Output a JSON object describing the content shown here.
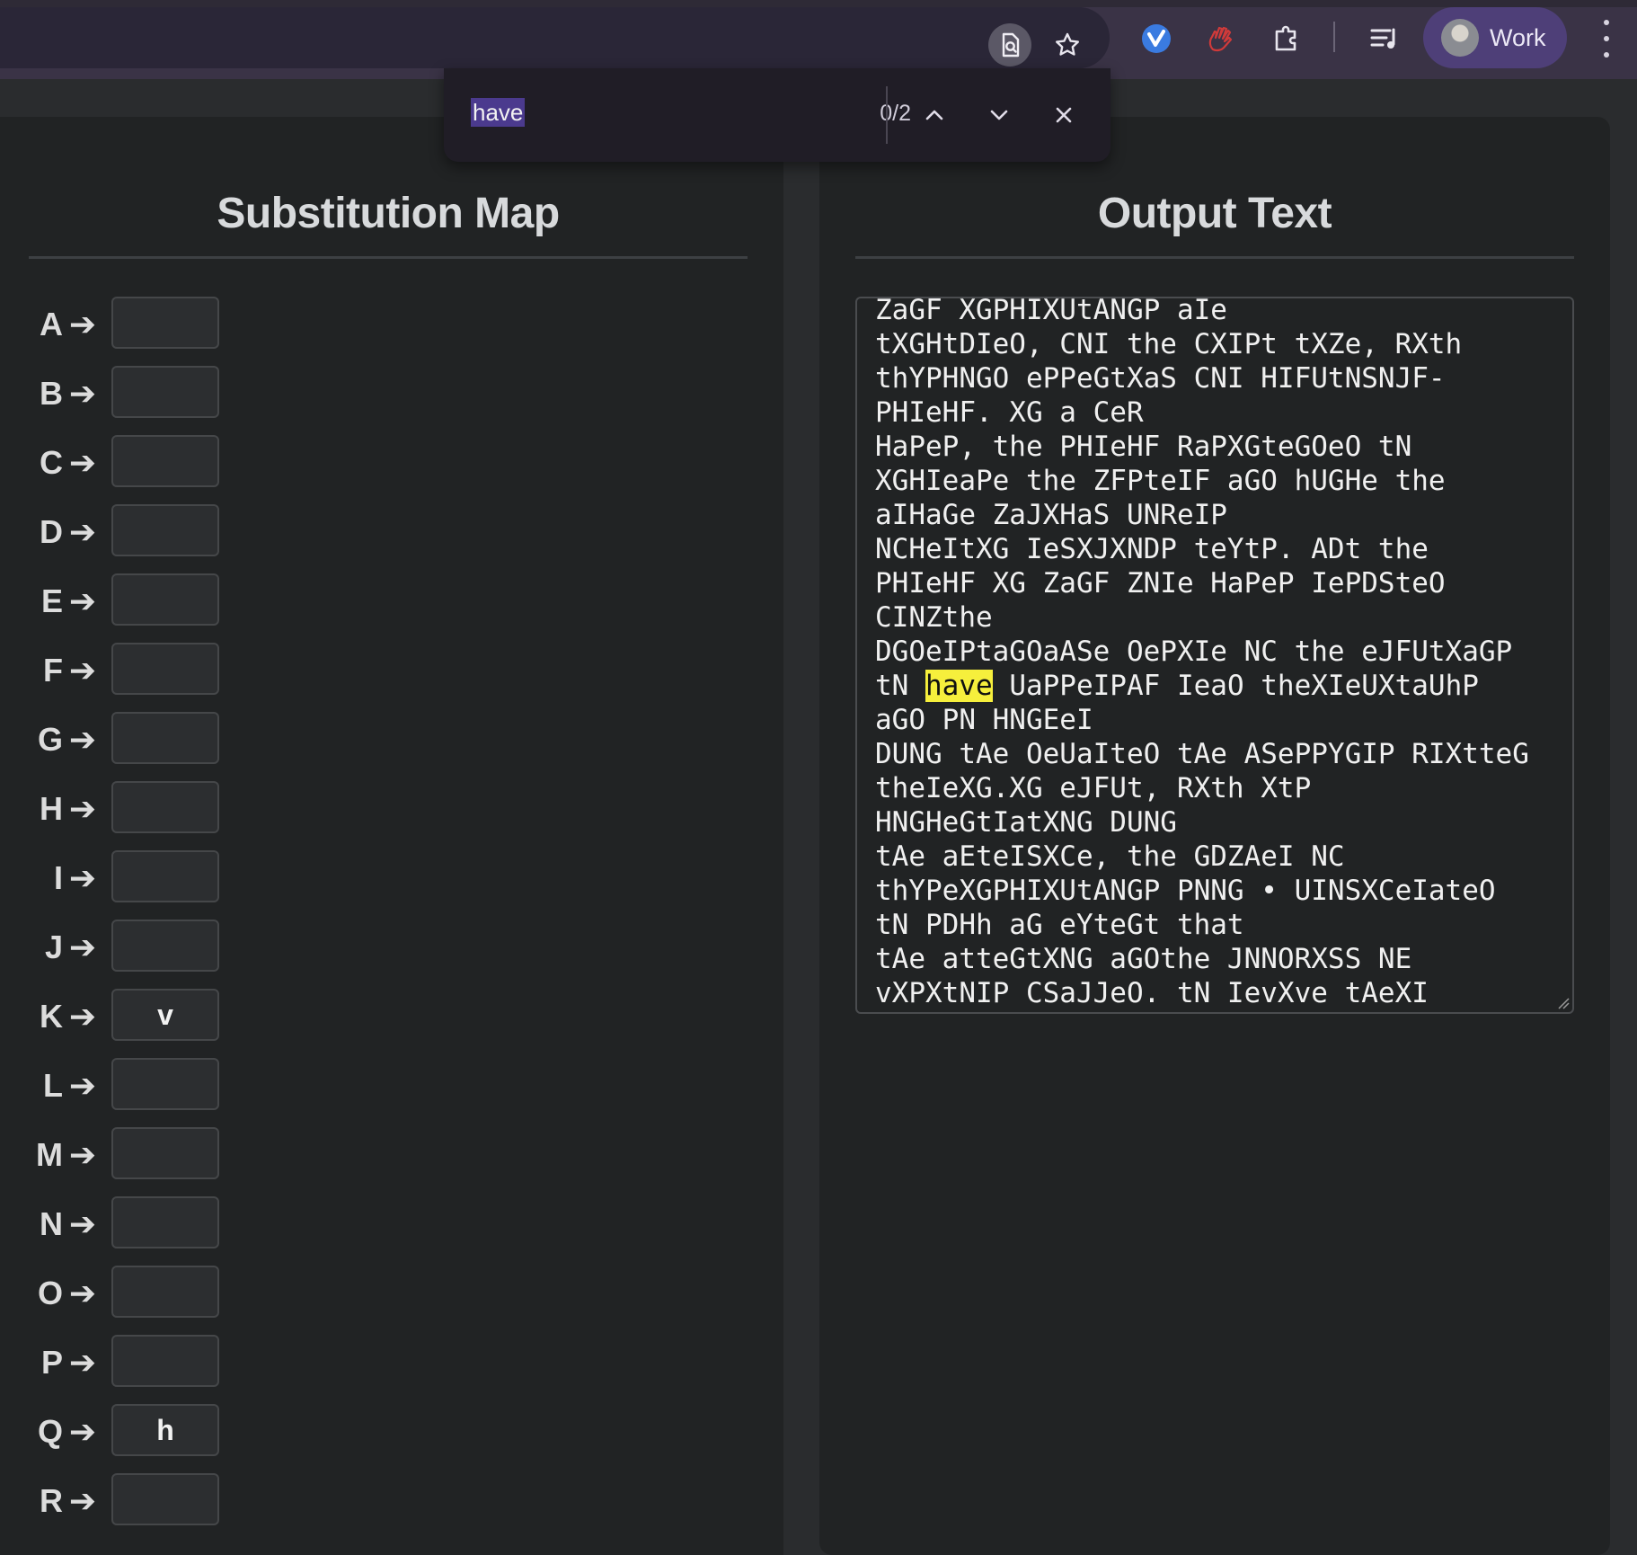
{
  "browser": {
    "profile_label": "Work",
    "toolbar_icons": [
      "page-search-icon",
      "bookmark-star-icon",
      "checkmark-extension-icon",
      "hand-extension-icon",
      "extensions-puzzle-icon",
      "media-queue-icon",
      "more-menu-icon"
    ]
  },
  "find_bar": {
    "query": "have",
    "count": "0/2"
  },
  "substitution_map": {
    "title": "Substitution Map",
    "rows": [
      {
        "letter": "A",
        "arrow": "➔",
        "value": ""
      },
      {
        "letter": "B",
        "arrow": "➔",
        "value": ""
      },
      {
        "letter": "C",
        "arrow": "➔",
        "value": ""
      },
      {
        "letter": "D",
        "arrow": "➔",
        "value": ""
      },
      {
        "letter": "E",
        "arrow": "➔",
        "value": ""
      },
      {
        "letter": "F",
        "arrow": "➔",
        "value": ""
      },
      {
        "letter": "G",
        "arrow": "➔",
        "value": ""
      },
      {
        "letter": "H",
        "arrow": "➔",
        "value": ""
      },
      {
        "letter": "I",
        "arrow": "➔",
        "value": ""
      },
      {
        "letter": "J",
        "arrow": "➔",
        "value": ""
      },
      {
        "letter": "K",
        "arrow": "➔",
        "value": "v"
      },
      {
        "letter": "L",
        "arrow": "➔",
        "value": ""
      },
      {
        "letter": "M",
        "arrow": "➔",
        "value": ""
      },
      {
        "letter": "N",
        "arrow": "➔",
        "value": ""
      },
      {
        "letter": "O",
        "arrow": "➔",
        "value": ""
      },
      {
        "letter": "P",
        "arrow": "➔",
        "value": ""
      },
      {
        "letter": "Q",
        "arrow": "➔",
        "value": "h"
      },
      {
        "letter": "R",
        "arrow": "➔",
        "value": ""
      }
    ]
  },
  "output": {
    "title": "Output Text",
    "highlight": "have",
    "lines": [
      "ZaGF XGPHIXUtANGP aIe",
      "tXGHtDIeO, CNI the CXIPt tXZe, RXth",
      "thYPHNGO ePPeGtXaS CNI HIFUtNSNJF-",
      "PHIeHF. XG a CeR",
      "HaPeP, the PHIeHF RaPXGteGOeO tN",
      "XGHIeaPe the ZFPteIF aGO hUGHe the",
      "aIHaGe ZaJXHaS UNReIP",
      "NCHeItXG IeSXJXNDP teYtP. ADt the",
      "PHIeHF XG ZaGF ZNIe HaPeP IePDSteO",
      "CINZthe",
      "DGOeIPtaGOaASe OePXIe NC the eJFUtXaGP",
      "tN have UaPPeIPAF IeaO theXIeUXtaUhP",
      "aGO PN HNGEeI",
      "DUNG tAe OeUaIteO tAe ASePPYGIP RIXtteG",
      "theIeXG.XG eJFUt, RXth XtP",
      "HNGHeGtIatXNG DUNG",
      "tAe aEteISXCe, the GDZAeI NC",
      "thYPeXGPHIXUtANGP PNNG • UINSXCeIateO",
      "tN PDHh aG eYteGt that",
      "tAe atteGtXNG aGOthe JNNORXSS NE",
      "vXPXtNIP CSaJJeO. tN IevXve tAeXI"
    ]
  }
}
